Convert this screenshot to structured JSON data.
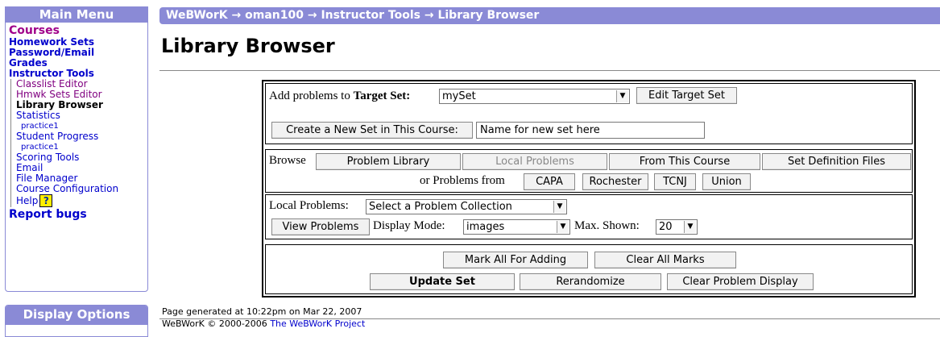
{
  "sidebar": {
    "title": "Main Menu",
    "items": {
      "courses": "Courses",
      "homework_sets": "Homework Sets",
      "password_email": "Password/Email",
      "grades": "Grades",
      "instructor_tools": "Instructor Tools",
      "classlist_editor": "Classlist Editor",
      "hmwk_sets_editor": "Hmwk Sets Editor",
      "library_browser": "Library Browser",
      "statistics": "Statistics",
      "statistics_practice": "practice1",
      "student_progress": "Student Progress",
      "progress_practice": "practice1",
      "scoring_tools": "Scoring Tools",
      "email": "Email",
      "file_manager": "File Manager",
      "course_configuration": "Course Configuration",
      "help": "Help",
      "report_bugs": "Report bugs"
    },
    "help_icon_glyph": "?"
  },
  "display_options": {
    "title": "Display Options"
  },
  "breadcrumb": "WeBWorK → oman100 → Instructor Tools → Library Browser",
  "page_title": "Library Browser",
  "target": {
    "label_prefix": "Add problems to ",
    "label_bold": "Target Set:",
    "selected": "mySet",
    "edit_button": "Edit Target Set",
    "create_button": "Create a New Set in This Course:",
    "new_set_value": "Name for new set here"
  },
  "browse": {
    "label": "Browse",
    "problem_library": "Problem Library",
    "local_problems": "Local Problems",
    "from_this_course": "From This Course",
    "set_definition_files": "Set Definition Files",
    "or_from": "or Problems from",
    "capa": "CAPA",
    "rochester": "Rochester",
    "tcnj": "TCNJ",
    "union": "Union"
  },
  "local": {
    "label": "Local Problems:",
    "collection": "Select a Problem Collection",
    "view_button": "View Problems",
    "display_mode_label": "Display Mode:",
    "display_mode": "images",
    "max_shown_label": "Max. Shown:",
    "max_shown": "20"
  },
  "actions": {
    "mark_all": "Mark All For Adding",
    "clear_marks": "Clear All Marks",
    "update_set": "Update Set",
    "rerandomize": "Rerandomize",
    "clear_display": "Clear Problem Display"
  },
  "footer": {
    "generated": "Page generated at 10:22pm on Mar 22, 2007",
    "copyright": "WeBWorK © 2000-2006",
    "project_link": "The WeBWorK Project"
  },
  "colors": {
    "header_bg": "#8a8ad6",
    "link": "#0000cc",
    "visited": "#800080",
    "courses": "#a0008a"
  }
}
